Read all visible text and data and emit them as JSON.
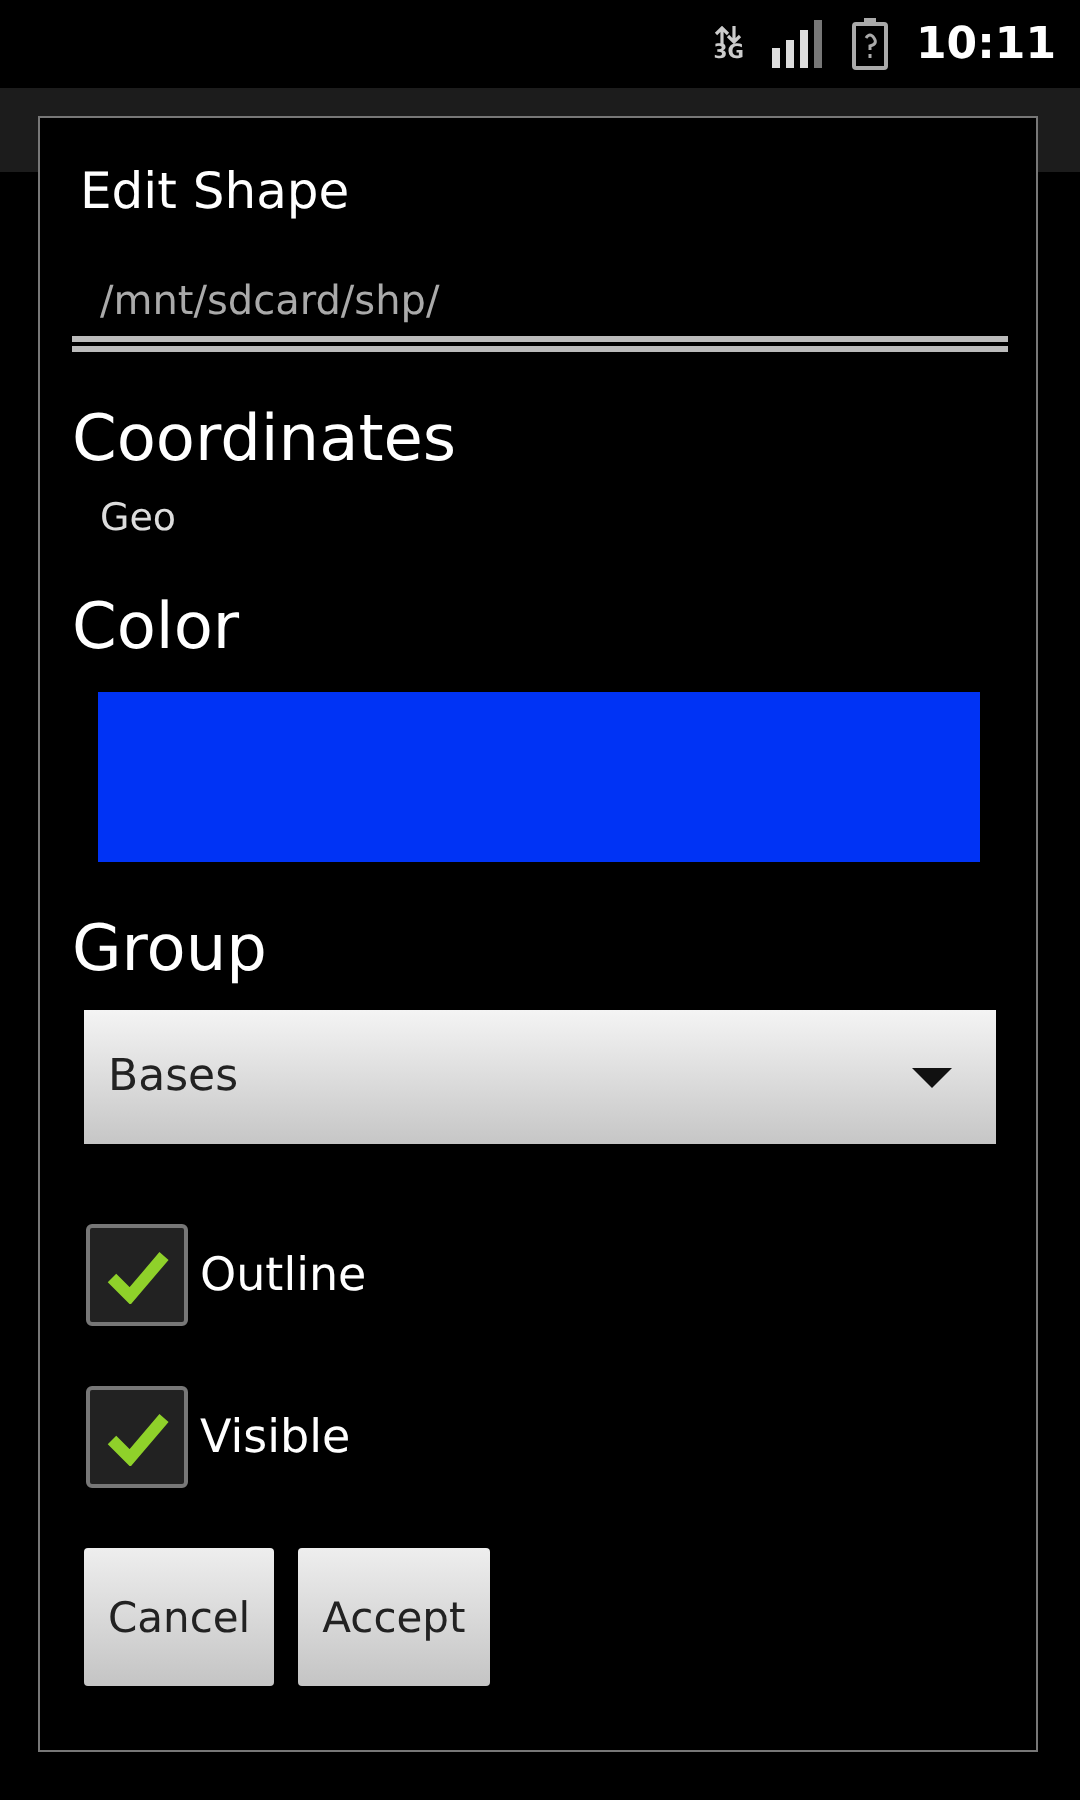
{
  "status_bar": {
    "network": "3G",
    "time": "10:11"
  },
  "dialog": {
    "title": "Edit Shape",
    "path_field": {
      "value": "/mnt/sdcard/shp/"
    },
    "sections": [
      {
        "kind": "text",
        "label": "Coordinates",
        "value": "Geo"
      },
      {
        "kind": "color",
        "label": "Color",
        "color": "#0033f5"
      },
      {
        "kind": "spinner",
        "label": "Group",
        "value": "Bases"
      }
    ],
    "checkboxes": [
      {
        "label": "Outline",
        "checked": true
      },
      {
        "label": "Visible",
        "checked": true
      }
    ],
    "buttons": [
      "Cancel",
      "Accept"
    ]
  }
}
